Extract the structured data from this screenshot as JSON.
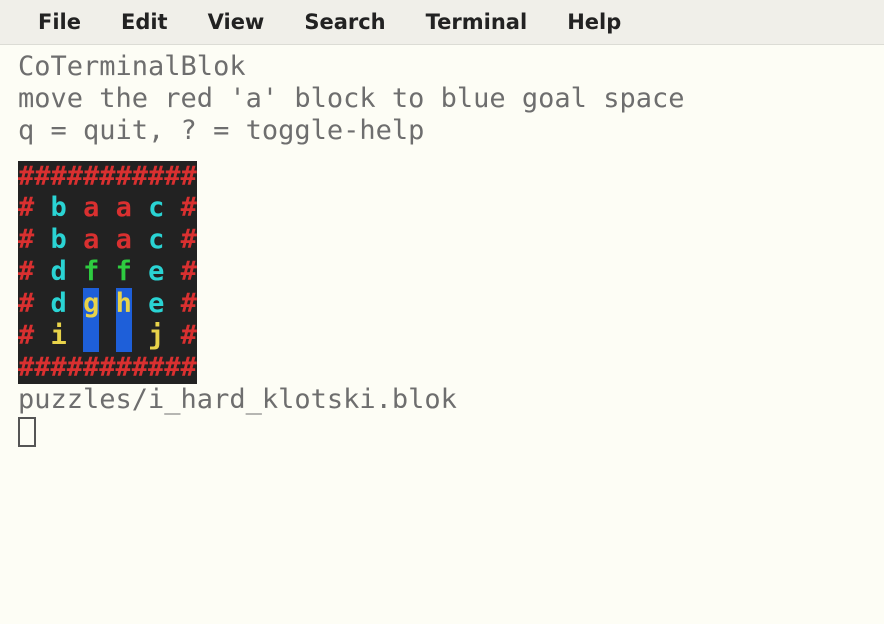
{
  "menubar": {
    "items": [
      "File",
      "Edit",
      "View",
      "Search",
      "Terminal",
      "Help"
    ]
  },
  "header": {
    "title": "CoTerminalBlok",
    "instruction": "move the red 'a' block to blue goal space",
    "keys": "q = quit,  ? = toggle-help"
  },
  "board": {
    "rows": [
      [
        {
          "t": "###########",
          "c": "red"
        }
      ],
      [
        {
          "t": "#",
          "c": "red"
        },
        {
          "t": " ",
          "c": "space"
        },
        {
          "t": "b",
          "c": "cyan"
        },
        {
          "t": " ",
          "c": "space"
        },
        {
          "t": "a",
          "c": "red"
        },
        {
          "t": " ",
          "c": "space"
        },
        {
          "t": "a",
          "c": "red"
        },
        {
          "t": " ",
          "c": "space"
        },
        {
          "t": "c",
          "c": "cyan"
        },
        {
          "t": " ",
          "c": "space"
        },
        {
          "t": "#",
          "c": "red"
        }
      ],
      [
        {
          "t": "#",
          "c": "red"
        },
        {
          "t": " ",
          "c": "space"
        },
        {
          "t": "b",
          "c": "cyan"
        },
        {
          "t": " ",
          "c": "space"
        },
        {
          "t": "a",
          "c": "red"
        },
        {
          "t": " ",
          "c": "space"
        },
        {
          "t": "a",
          "c": "red"
        },
        {
          "t": " ",
          "c": "space"
        },
        {
          "t": "c",
          "c": "cyan"
        },
        {
          "t": " ",
          "c": "space"
        },
        {
          "t": "#",
          "c": "red"
        }
      ],
      [
        {
          "t": "#",
          "c": "red"
        },
        {
          "t": " ",
          "c": "space"
        },
        {
          "t": "d",
          "c": "cyan"
        },
        {
          "t": " ",
          "c": "space"
        },
        {
          "t": "f",
          "c": "green"
        },
        {
          "t": " ",
          "c": "space"
        },
        {
          "t": "f",
          "c": "green"
        },
        {
          "t": " ",
          "c": "space"
        },
        {
          "t": "e",
          "c": "cyan"
        },
        {
          "t": " ",
          "c": "space"
        },
        {
          "t": "#",
          "c": "red"
        }
      ],
      [
        {
          "t": "#",
          "c": "red"
        },
        {
          "t": " ",
          "c": "space"
        },
        {
          "t": "d",
          "c": "cyan"
        },
        {
          "t": " ",
          "c": "space"
        },
        {
          "t": "g",
          "c": "yellow",
          "g": true
        },
        {
          "t": " ",
          "c": "space"
        },
        {
          "t": "h",
          "c": "yellow",
          "g": true
        },
        {
          "t": " ",
          "c": "space"
        },
        {
          "t": "e",
          "c": "cyan"
        },
        {
          "t": " ",
          "c": "space"
        },
        {
          "t": "#",
          "c": "red"
        }
      ],
      [
        {
          "t": "#",
          "c": "red"
        },
        {
          "t": " ",
          "c": "space"
        },
        {
          "t": "i",
          "c": "yellow"
        },
        {
          "t": " ",
          "c": "space"
        },
        {
          "t": " ",
          "c": "space",
          "g": true
        },
        {
          "t": " ",
          "c": "space"
        },
        {
          "t": " ",
          "c": "space",
          "g": true
        },
        {
          "t": " ",
          "c": "space"
        },
        {
          "t": "j",
          "c": "yellow"
        },
        {
          "t": " ",
          "c": "space"
        },
        {
          "t": "#",
          "c": "red"
        }
      ],
      [
        {
          "t": "###########",
          "c": "red"
        }
      ]
    ]
  },
  "footer": {
    "path": "puzzles/i_hard_klotski.blok"
  }
}
